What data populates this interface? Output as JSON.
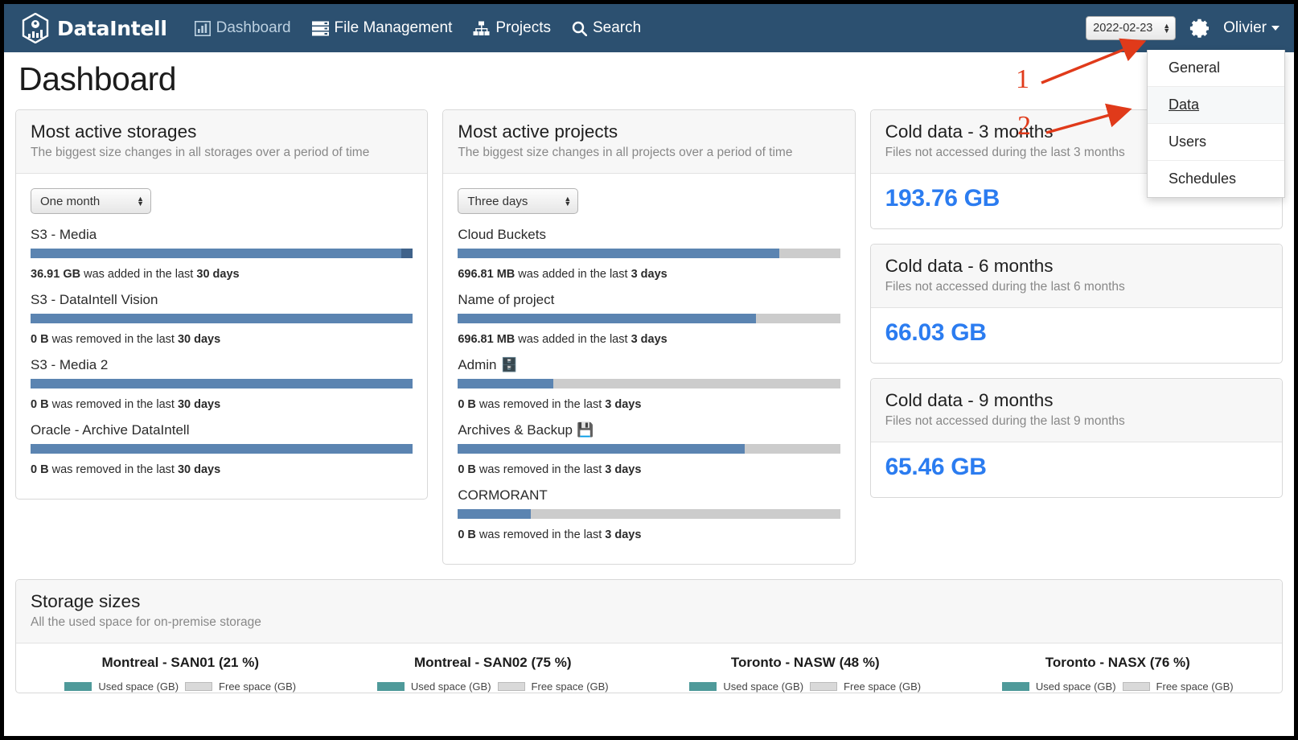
{
  "navbar": {
    "brand": "DataIntell",
    "brand_logo_icon": "hexagon-chart-logo-icon",
    "links": [
      {
        "label": "Dashboard",
        "icon": "bar-chart-icon",
        "active": true
      },
      {
        "label": "File Management",
        "icon": "server-stack-icon",
        "active": false
      },
      {
        "label": "Projects",
        "icon": "sitemap-icon",
        "active": false
      },
      {
        "label": "Search",
        "icon": "magnifier-icon",
        "active": false
      }
    ],
    "date_value": "2022-02-23",
    "gear_icon": "gear-icon",
    "user_label": "Olivier",
    "caret_icon": "caret-down-icon"
  },
  "settings_dropdown": {
    "items": [
      {
        "label": "General",
        "hovered": false
      },
      {
        "label": "Data",
        "hovered": true
      },
      {
        "label": "Users",
        "hovered": false
      },
      {
        "label": "Schedules",
        "hovered": false
      }
    ]
  },
  "page": {
    "title": "Dashboard"
  },
  "most_active_storages": {
    "title": "Most active storages",
    "subtitle": "The biggest size changes in all storages over a period of time",
    "period_selected": "One month",
    "items": [
      {
        "name": "S3 - Media",
        "fill_percent": 97,
        "capped": true,
        "amount": "36.91 GB",
        "action": "was added in the last",
        "period": "30 days"
      },
      {
        "name": "S3 - DataIntell Vision",
        "fill_percent": 100,
        "capped": false,
        "amount": "0 B",
        "action": "was removed in the last",
        "period": "30 days"
      },
      {
        "name": "S3 - Media 2",
        "fill_percent": 100,
        "capped": false,
        "amount": "0 B",
        "action": "was removed in the last",
        "period": "30 days"
      },
      {
        "name": "Oracle - Archive DataIntell",
        "fill_percent": 100,
        "capped": false,
        "amount": "0 B",
        "action": "was removed in the last",
        "period": "30 days"
      }
    ]
  },
  "most_active_projects": {
    "title": "Most active projects",
    "subtitle": "The biggest size changes in all projects over a period of time",
    "period_selected": "Three days",
    "items": [
      {
        "name": "Cloud Buckets",
        "emoji": "",
        "fill_percent": 84,
        "amount": "696.81 MB",
        "action": "was added in the last",
        "period": "3 days"
      },
      {
        "name": "Name of project",
        "emoji": "",
        "fill_percent": 78,
        "amount": "696.81 MB",
        "action": "was added in the last",
        "period": "3 days"
      },
      {
        "name": "Admin",
        "emoji": "🗄️",
        "emoji_name": "file-cabinet-emoji",
        "fill_percent": 25,
        "amount": "0 B",
        "action": "was removed in the last",
        "period": "3 days"
      },
      {
        "name": "Archives & Backup",
        "emoji": "💾",
        "emoji_name": "floppy-disk-emoji",
        "fill_percent": 75,
        "amount": "0 B",
        "action": "was removed in the last",
        "period": "3 days"
      },
      {
        "name": "CORMORANT",
        "emoji": "",
        "fill_percent": 19,
        "amount": "0 B",
        "action": "was removed in the last",
        "period": "3 days"
      }
    ]
  },
  "cold_data_cards": [
    {
      "title": "Cold data - 3 months",
      "subtitle": "Files not accessed during the last 3 months",
      "value": "193.76 GB"
    },
    {
      "title": "Cold data - 6 months",
      "subtitle": "Files not accessed during the last 6 months",
      "value": "66.03 GB"
    },
    {
      "title": "Cold data - 9 months",
      "subtitle": "Files not accessed during the last 9 months",
      "value": "65.46 GB"
    }
  ],
  "storage_sizes": {
    "title": "Storage sizes",
    "subtitle": "All the used space for on-premise storage",
    "charts": [
      {
        "title": "Montreal - SAN01 (21 %)",
        "used_label": "Used space (GB)",
        "free_label": "Free space (GB)"
      },
      {
        "title": "Montreal - SAN02 (75 %)",
        "used_label": "Used space (GB)",
        "free_label": "Free space (GB)"
      },
      {
        "title": "Toronto - NASW (48 %)",
        "used_label": "Used space (GB)",
        "free_label": "Free space (GB)"
      },
      {
        "title": "Toronto - NASX (76 %)",
        "used_label": "Used space (GB)",
        "free_label": "Free space (GB)"
      }
    ]
  },
  "annotations": {
    "marker_color": "#e03a1a",
    "markers": [
      {
        "label": "1"
      },
      {
        "label": "2"
      }
    ]
  }
}
